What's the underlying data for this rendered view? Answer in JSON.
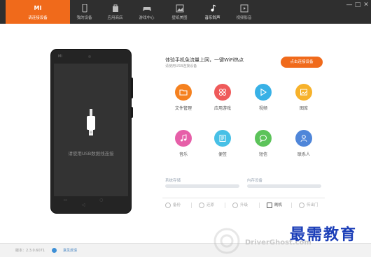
{
  "nav": {
    "items": [
      {
        "label": "请连接设备",
        "icon": "mi-logo-icon",
        "active": true
      },
      {
        "label": "我的设备",
        "icon": "phone-icon"
      },
      {
        "label": "应用商店",
        "icon": "bag-icon"
      },
      {
        "label": "游戏中心",
        "icon": "gamepad-icon"
      },
      {
        "label": "壁纸美图",
        "icon": "picture-icon"
      },
      {
        "label": "音乐铃声",
        "icon": "music-note-icon"
      },
      {
        "label": "视频影音",
        "icon": "video-icon"
      }
    ],
    "logo_text": "MI",
    "window_controls": {
      "minimize": "—",
      "maximize": "□",
      "close": "✕"
    }
  },
  "phone": {
    "brand": "MI",
    "connect_prompt": "请使用USB数据线连接",
    "nav_keys": "▭ ○ ◁"
  },
  "hotspot": {
    "title": "体验手机免流量上网，一键WiFi热点",
    "subtitle": "请使用USB连接设备",
    "button_label": "点击连接设备",
    "accent_color": "#f06a1b"
  },
  "apps": [
    {
      "label": "文件管理",
      "icon": "folder-icon",
      "color": "#f5811f"
    },
    {
      "label": "应用游戏",
      "icon": "grid-icon",
      "color": "#ef5a5a"
    },
    {
      "label": "视频",
      "icon": "play-icon",
      "color": "#38b1e6"
    },
    {
      "label": "图库",
      "icon": "gallery-icon",
      "color": "#f7b22b"
    },
    {
      "label": "音乐",
      "icon": "music-icon",
      "color": "#e65fa8"
    },
    {
      "label": "便签",
      "icon": "note-icon",
      "color": "#47c0e6"
    },
    {
      "label": "短信",
      "icon": "message-icon",
      "color": "#5cc35a"
    },
    {
      "label": "联系人",
      "icon": "contact-icon",
      "color": "#4f86d9"
    }
  ],
  "storage": {
    "system_label": "系统存储",
    "internal_label": "内存设备"
  },
  "tools": [
    {
      "label": "备份",
      "icon": "backup-icon"
    },
    {
      "label": "还原",
      "icon": "restore-icon"
    },
    {
      "label": "升级",
      "icon": "upgrade-icon"
    },
    {
      "label": "刷机",
      "icon": "flash-icon"
    },
    {
      "label": "传出门",
      "icon": "send-icon"
    }
  ],
  "status": {
    "version": "版本：2.3.0.6071",
    "feedback": "意见反馈"
  },
  "watermark": {
    "site": "DriverGhost.com",
    "chinese": "最需教育"
  }
}
